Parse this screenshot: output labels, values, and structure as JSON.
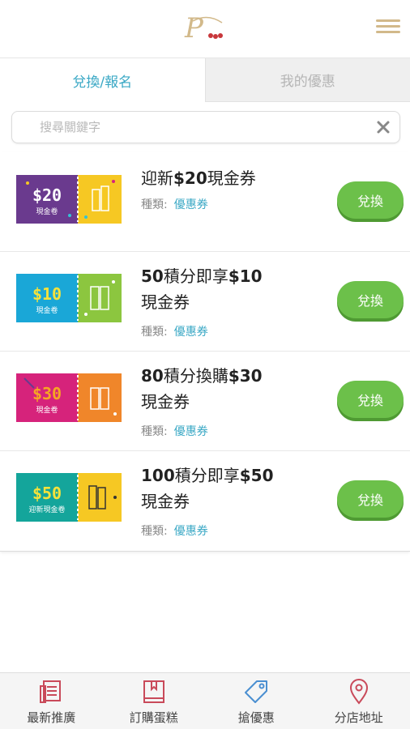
{
  "header": {
    "logo_text": "P",
    "menu_icon": "hamburger-icon"
  },
  "tabs": [
    {
      "label": "兌換/報名",
      "active": true
    },
    {
      "label": "我的優惠",
      "active": false
    }
  ],
  "search": {
    "placeholder": "搜尋關鍵字",
    "value": ""
  },
  "items": [
    {
      "ticket_amount": "$20",
      "ticket_caption": "現金卷",
      "ticket_colors": [
        "#6a3a8e",
        "#f6c823"
      ],
      "title_pre": "迎新",
      "title_bold": "$20",
      "title_post": "現金券",
      "type_label": "種類:",
      "type_value": "優惠券",
      "button": "兌換"
    },
    {
      "ticket_amount": "$10",
      "ticket_caption": "現金卷",
      "ticket_colors": [
        "#1aa7d7",
        "#8cc63f"
      ],
      "title_pre": "",
      "title_bold": "50",
      "title_post": "積分即享",
      "title_bold2": "$10",
      "title_line2": "現金券",
      "type_label": "種類:",
      "type_value": "優惠券",
      "button": "兌換"
    },
    {
      "ticket_amount": "$30",
      "ticket_caption": "現金卷",
      "ticket_colors": [
        "#d6237b",
        "#f0862a"
      ],
      "title_pre": "",
      "title_bold": "80",
      "title_post": "積分換購",
      "title_bold2": "$30",
      "title_line2": "現金券",
      "type_label": "種類:",
      "type_value": "優惠券",
      "button": "兌換"
    },
    {
      "ticket_amount": "$50",
      "ticket_caption": "迎新現金卷",
      "ticket_colors": [
        "#14a59b",
        "#f6c823"
      ],
      "title_pre": "",
      "title_bold": "100",
      "title_post": "積分即享",
      "title_bold2": "$50",
      "title_line2": "現金券",
      "type_label": "種類:",
      "type_value": "優惠券",
      "button": "兌換"
    }
  ],
  "nav": [
    {
      "label": "最新推廣",
      "icon": "news-icon"
    },
    {
      "label": "訂購蛋糕",
      "icon": "book-icon"
    },
    {
      "label": "搶優惠",
      "icon": "tag-icon"
    },
    {
      "label": "分店地址",
      "icon": "location-pin-icon"
    }
  ],
  "colors": {
    "accent": "#3aa8c5",
    "button": "#6cc04a",
    "nav_icon": "#c94a5a",
    "tag_icon": "#4a8fd1"
  }
}
